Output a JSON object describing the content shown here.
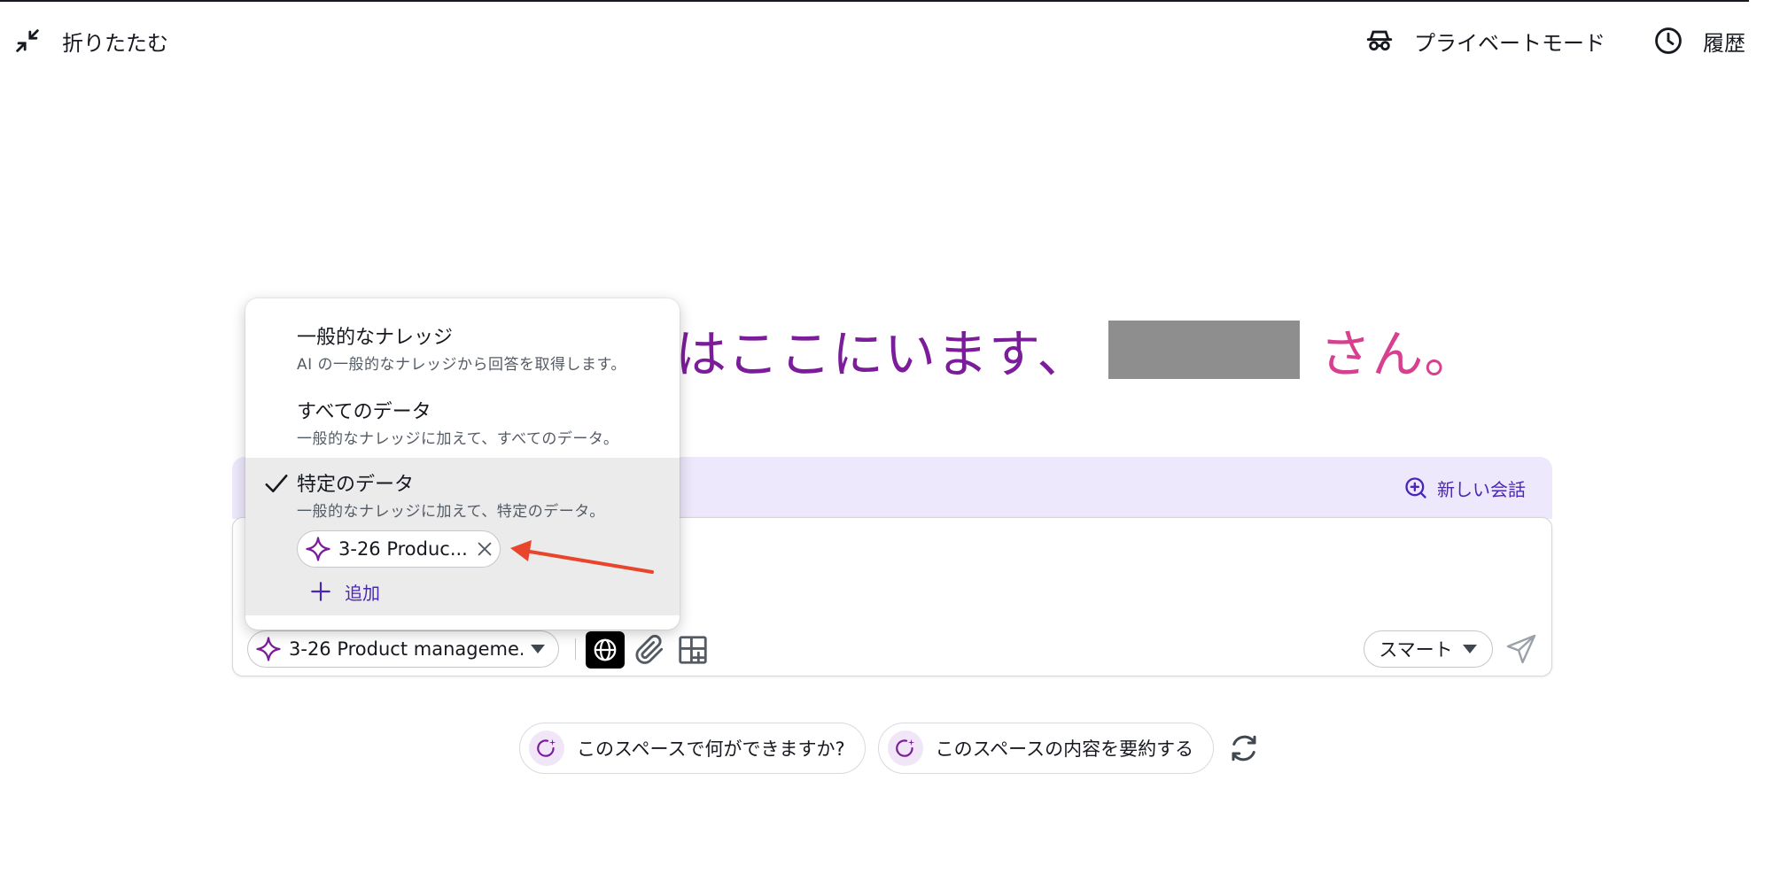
{
  "topbar": {
    "collapse_label": "折りたたむ",
    "private_mode_label": "プライベートモード",
    "history_label": "履歴"
  },
  "greeting": {
    "text": "はここにいます、",
    "suffix": "さん。"
  },
  "chat": {
    "new_chat_label": "新しい会話",
    "source_chip_label": "3-26 Product manageme...",
    "mode_label": "スマート"
  },
  "dropdown": {
    "options": [
      {
        "title": "一般的なナレッジ",
        "desc": "AI の一般的なナレッジから回答を取得します。"
      },
      {
        "title": "すべてのデータ",
        "desc": "一般的なナレッジに加えて、すべてのデータ。"
      },
      {
        "title": "特定のデータ",
        "desc": "一般的なナレッジに加えて、特定のデータ。"
      }
    ],
    "selected_index": 2,
    "data_chip_label": "3-26 Produc...",
    "add_label": "追加"
  },
  "suggestions": [
    "このスペースで何ができますか?",
    "このスペースの内容を要約する"
  ],
  "colors": {
    "accent": "#4a26b8",
    "greeting_purple": "#7b1c9a",
    "greeting_pink": "#d6408e",
    "band": "#ede8fb",
    "annotation_arrow": "#e8452c"
  }
}
